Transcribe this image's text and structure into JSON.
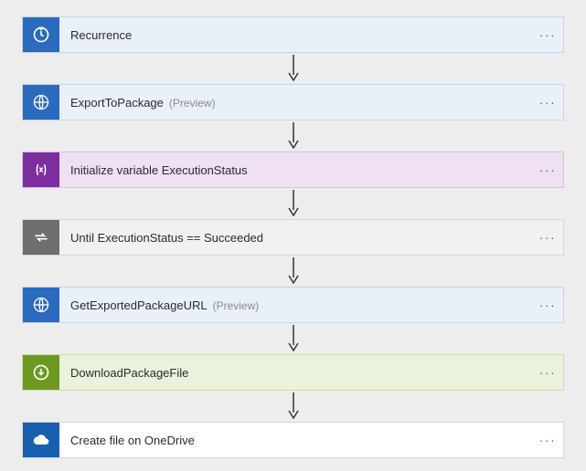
{
  "steps": [
    {
      "label": "Recurrence",
      "suffix": "",
      "theme": "blue",
      "icon": "clock-icon"
    },
    {
      "label": "ExportToPackage",
      "suffix": "(Preview)",
      "theme": "blue",
      "icon": "globe-icon"
    },
    {
      "label": "Initialize variable ExecutionStatus",
      "suffix": "",
      "theme": "purple",
      "icon": "variable-icon"
    },
    {
      "label": "Until ExecutionStatus == Succeeded",
      "suffix": "",
      "theme": "grey",
      "icon": "loop-icon"
    },
    {
      "label": "GetExportedPackageURL",
      "suffix": "(Preview)",
      "theme": "blue",
      "icon": "globe-icon"
    },
    {
      "label": "DownloadPackageFile",
      "suffix": "",
      "theme": "green",
      "icon": "download-icon"
    },
    {
      "label": "Create file on OneDrive",
      "suffix": "",
      "theme": "white",
      "icon": "cloud-icon"
    }
  ],
  "more_label": "···"
}
